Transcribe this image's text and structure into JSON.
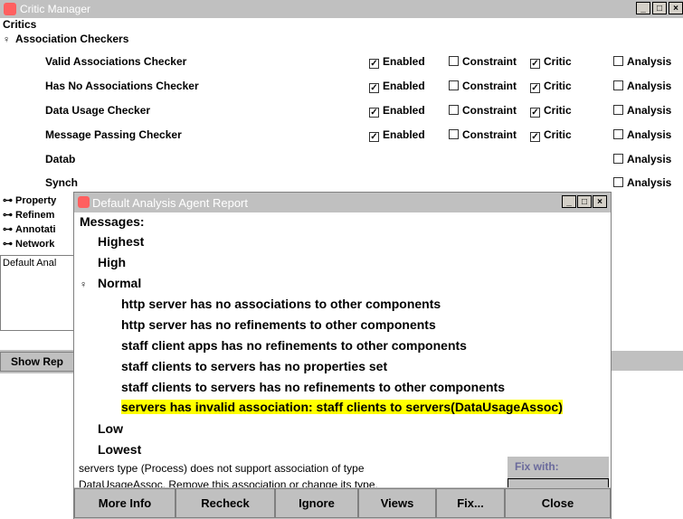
{
  "window": {
    "title": "Critic Manager",
    "min": "_",
    "max": "□",
    "close": "×"
  },
  "critics": {
    "header": "Critics",
    "group": "Association Checkers",
    "items": [
      {
        "label": "Valid Associations Checker",
        "enabled": "Enabled",
        "constraint": "Constraint",
        "critic": "Critic",
        "analysis": "Analysis"
      },
      {
        "label": "Has No Associations Checker",
        "enabled": "Enabled",
        "constraint": "Constraint",
        "critic": "Critic",
        "analysis": "Analysis"
      },
      {
        "label": "Data Usage Checker",
        "enabled": "Enabled",
        "constraint": "Constraint",
        "critic": "Critic",
        "analysis": "Analysis"
      },
      {
        "label": "Message Passing Checker",
        "enabled": "Enabled",
        "constraint": "Constraint",
        "critic": "Critic",
        "analysis": "Analysis"
      },
      {
        "label": "Datab",
        "analysis": "Analysis"
      },
      {
        "label": "Synch",
        "analysis": "Analysis"
      }
    ],
    "collapsed": [
      "Property",
      "Refinem",
      "Annotati",
      "Network"
    ]
  },
  "panel_text": "Default Anal",
  "show_button": "Show Rep",
  "dialog": {
    "title": "Default Analysis Agent Report",
    "messages_label": "Messages:",
    "levels": [
      "Highest",
      "High",
      "Normal",
      "Low",
      "Lowest"
    ],
    "normal_items": [
      "http server has no associations to other components",
      "http server has no refinements to other components",
      "staff client apps has no refinements to other components",
      "staff clients to servers has no properties set",
      "staff clients to servers has no refinements to other components",
      "servers has invalid association: staff clients to servers(DataUsageAssoc)"
    ],
    "description_line1": "servers type (Process) does not support association of type",
    "description_line2": "DataUsageAssoc. Remove this association or change its type.",
    "fix_with_label": "Fix with:",
    "buttons": [
      "More Info",
      "Recheck",
      "Ignore",
      "Views",
      "Fix...",
      "Close"
    ]
  }
}
